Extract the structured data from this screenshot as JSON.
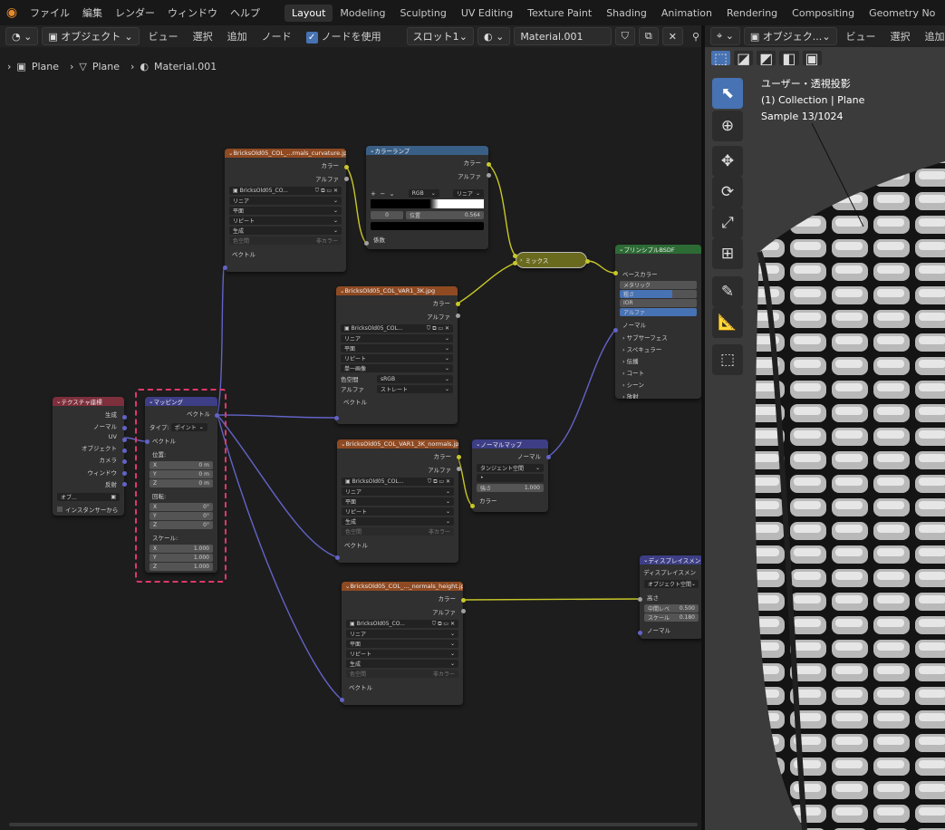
{
  "menubar": {
    "items": [
      "ファイル",
      "編集",
      "レンダー",
      "ウィンドウ",
      "ヘルプ"
    ],
    "workspaces": [
      "Layout",
      "Modeling",
      "Sculpting",
      "UV Editing",
      "Texture Paint",
      "Shading",
      "Animation",
      "Rendering",
      "Compositing",
      "Geometry No"
    ],
    "active_workspace": "Layout"
  },
  "node_header": {
    "mode": "オブジェクト",
    "menus": [
      "ビュー",
      "選択",
      "追加",
      "ノード"
    ],
    "use_nodes_label": "ノードを使用",
    "slot": "スロット1",
    "material": "Material.001"
  },
  "breadcrumb": {
    "items": [
      "Plane",
      "Plane",
      "Material.001"
    ]
  },
  "nodes": {
    "texcoord": {
      "title": "テクスチャ座標",
      "outputs": [
        "生成",
        "ノーマル",
        "UV",
        "オブジェクト",
        "カメラ",
        "ウィンドウ",
        "反射"
      ],
      "object_label": "オブ...",
      "instancer": "インスタンサーから"
    },
    "mapping": {
      "title": "マッピング",
      "out": "ベクトル",
      "type_label": "タイプ:",
      "type_value": "ポイント",
      "in_vector": "ベクトル",
      "loc_label": "位置:",
      "rot_label": "回転:",
      "scale_label": "スケール:",
      "loc": [
        {
          "axis": "X",
          "value": "0 m"
        },
        {
          "axis": "Y",
          "value": "0 m"
        },
        {
          "axis": "Z",
          "value": "0 m"
        }
      ],
      "rot": [
        {
          "axis": "X",
          "value": "0°"
        },
        {
          "axis": "Y",
          "value": "0°"
        },
        {
          "axis": "Z",
          "value": "0°"
        }
      ],
      "scale": [
        {
          "axis": "X",
          "value": "1.000"
        },
        {
          "axis": "Y",
          "value": "1.000"
        },
        {
          "axis": "Z",
          "value": "1.000"
        }
      ]
    },
    "img1": {
      "title": "BricksOld05_COL_...rmals_curvature.jpg",
      "out1": "カラー",
      "out2": "アルファ",
      "file": "BricksOld05_CO...",
      "interp": "リニア",
      "proj": "平面",
      "ext": "リピート",
      "source": "生成",
      "cs_label": "色空間",
      "cs_value": "非カラー",
      "vec": "ベクトル"
    },
    "ramp": {
      "title": "カラーランプ",
      "out1": "カラー",
      "out2": "アルファ",
      "mode": "RGB",
      "interp": "リニア",
      "index": "0",
      "pos_label": "位置",
      "pos_value": "0.564",
      "fac": "係数"
    },
    "mix": {
      "title": "ミックス"
    },
    "img2": {
      "title": "BricksOld05_COL_VAR1_3K.jpg",
      "out1": "カラー",
      "out2": "アルファ",
      "file": "BricksOld05_COL...",
      "interp": "リニア",
      "proj": "平面",
      "ext": "リピート",
      "source": "単一画像",
      "cs_label": "色空間",
      "cs_value": "sRGB",
      "alpha_label": "アルファ",
      "alpha_value": "ストレート",
      "vec": "ベクトル"
    },
    "img3": {
      "title": "BricksOld05_COL_VAR1_3K_normals.jpg",
      "out1": "カラー",
      "out2": "アルファ",
      "file": "BricksOld05_COL...",
      "interp": "リニア",
      "proj": "平面",
      "ext": "リピート",
      "source": "生成",
      "cs_label": "色空間",
      "cs_value": "非カラー",
      "vec": "ベクトル"
    },
    "normalmap": {
      "title": "ノーマルマップ",
      "out": "ノーマル",
      "space": "タンジェント空間",
      "strength_label": "強さ",
      "strength_value": "1.000",
      "color": "カラー"
    },
    "img4": {
      "title": "BricksOld05_COL_..._normals_height.jpg",
      "out1": "カラー",
      "out2": "アルファ",
      "file": "BricksOld05_CO...",
      "interp": "リニア",
      "proj": "平面",
      "ext": "リピート",
      "source": "生成",
      "cs_label": "色空間",
      "cs_value": "非カラー",
      "vec": "ベクトル"
    },
    "bsdf": {
      "title": "プリンシプルBSDF",
      "base": "ベースカラー",
      "metal": "メタリック",
      "rough": "粗さ",
      "ior": "IOR",
      "alpha": "アルファ",
      "normal": "ノーマル",
      "panels": [
        "サブサーフェス",
        "スペキュラー",
        "伝播",
        "コート",
        "シーン",
        "放射"
      ]
    },
    "disp": {
      "title": "ディスプレイスメン",
      "out": "ディスプレイスメン",
      "space": "オブジェクト空間",
      "height": "高さ",
      "mid_label": "中間レベ",
      "mid_value": "0.500",
      "scale_label": "スケール",
      "scale_value": "0.180",
      "normal": "ノーマル"
    }
  },
  "viewport": {
    "mode": "オブジェク...",
    "menus": [
      "ビュー",
      "選択",
      "追加"
    ],
    "info_line1": "ユーザー・透視投影",
    "info_line2": "(1) Collection | Plane",
    "info_line3": "Sample 13/1024"
  },
  "colors": {
    "accent": "#4772b3",
    "selection": "#e0386a",
    "link_vector": "#6363c7",
    "link_color": "#c7c729",
    "link_float": "#a1a1a1"
  }
}
